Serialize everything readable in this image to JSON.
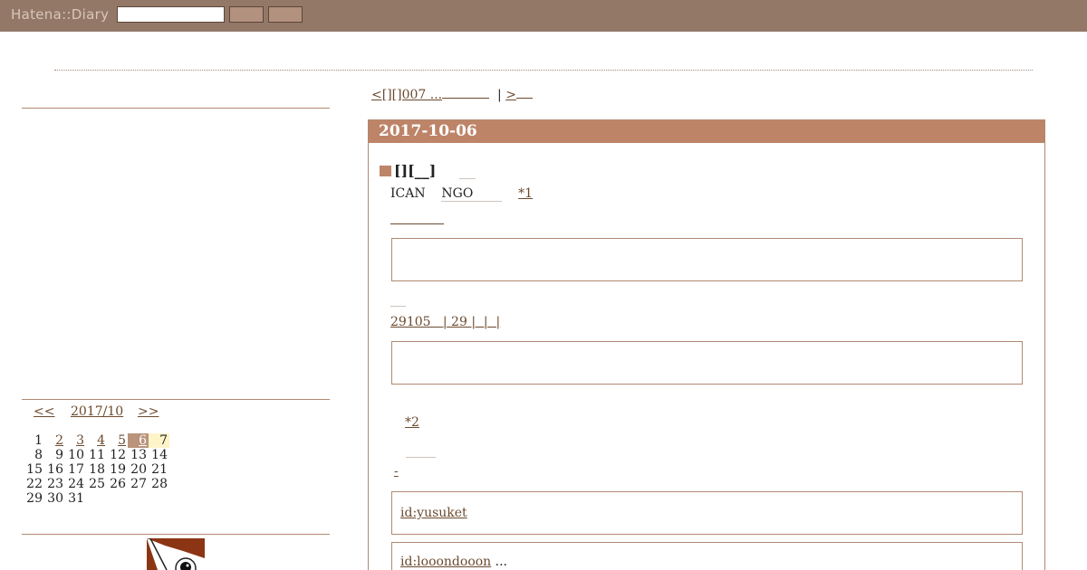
{
  "header": {
    "logo": "Hatena::Diary",
    "search_placeholder": "",
    "button1": "",
    "button2": ""
  },
  "calendar": {
    "prev": "<<",
    "month": "2017/10",
    "next": ">>",
    "weeks": [
      [
        "",
        "1",
        "2",
        "3",
        "4",
        "5",
        "6",
        "7"
      ],
      [
        "8",
        "9",
        "10",
        "11",
        "12",
        "13",
        "14"
      ],
      [
        "15",
        "16",
        "17",
        "18",
        "19",
        "20",
        "21"
      ],
      [
        "22",
        "23",
        "24",
        "25",
        "26",
        "27",
        "28"
      ],
      [
        "29",
        "30",
        "31"
      ]
    ],
    "linked_days": [
      "2",
      "3",
      "4",
      "5",
      "6"
    ],
    "today": "6",
    "highlight": "7"
  },
  "pager": {
    "prev": "<[][]007 ...",
    "separator": "|",
    "next": ">"
  },
  "entry": {
    "date": "2017-10-06",
    "section_title": "[][__]",
    "line1_a": "ICAN",
    "line1_b": "NGO",
    "footnote1": "*1",
    "line2": "29105   | 29 |  |  |",
    "footnote2": "*2",
    "link3": "-",
    "comment1_user": "id:yusuket",
    "comment2_user": "id:looondooon",
    "comment2_tail": "..."
  },
  "colors": {
    "topbar": "#937868",
    "accent": "#bd8468",
    "link": "#6b4a2e"
  }
}
